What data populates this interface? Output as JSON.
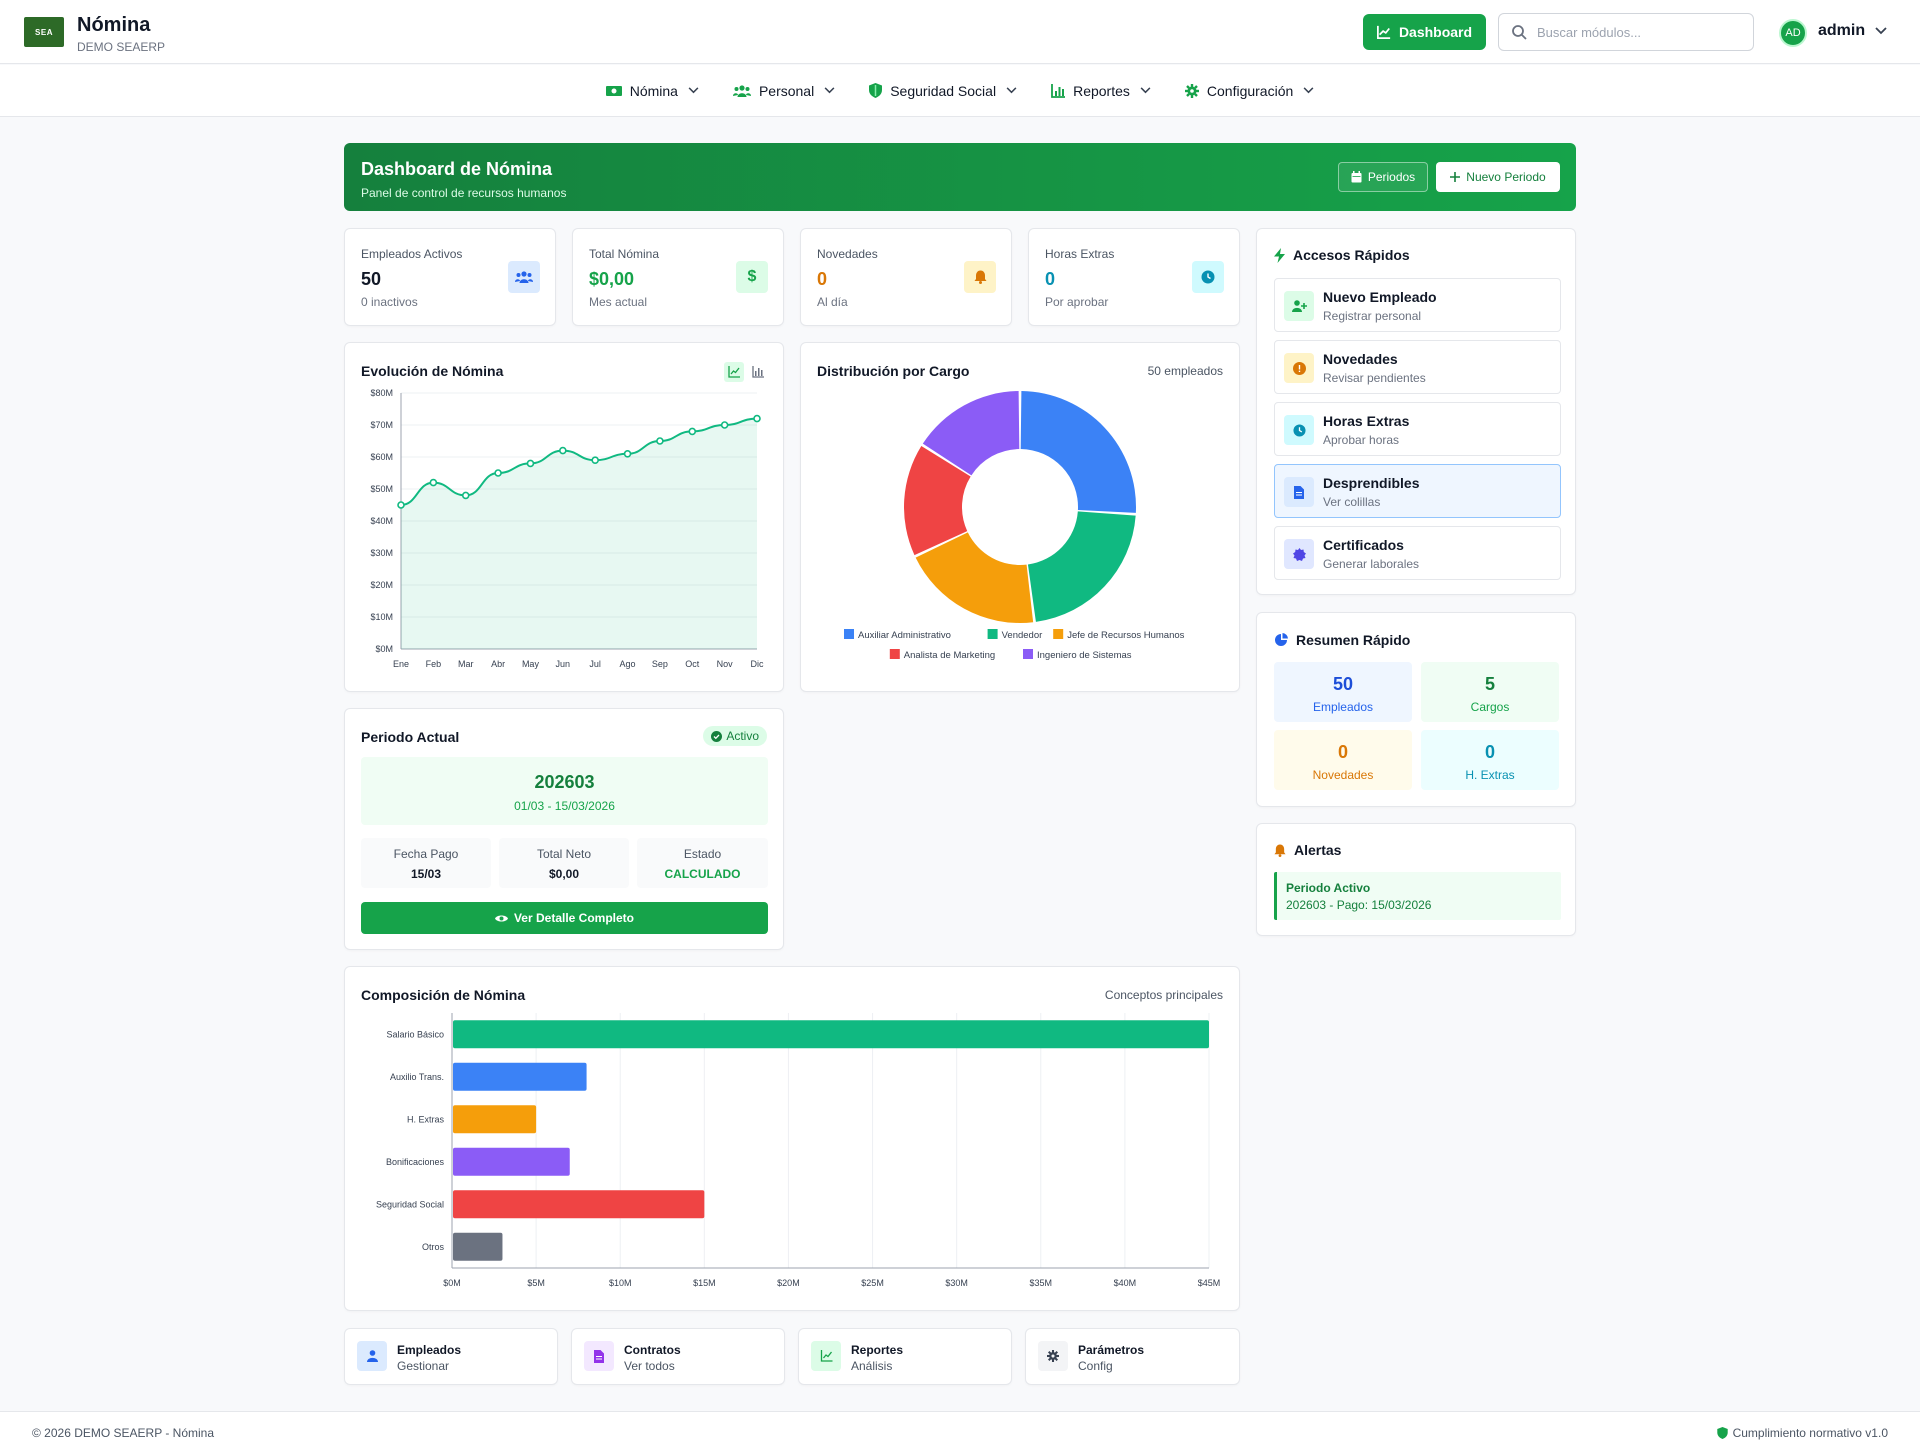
{
  "header": {
    "logo_text": "SEA",
    "title": "Nómina",
    "subtitle": "DEMO SEAERP",
    "dashboard_label": "Dashboard",
    "search_placeholder": "Buscar módulos...",
    "avatar_initials": "AD",
    "user_name": "admin"
  },
  "nav": {
    "items": [
      {
        "label": "Nómina",
        "icon": "money-icon"
      },
      {
        "label": "Personal",
        "icon": "users-icon"
      },
      {
        "label": "Seguridad Social",
        "icon": "shield-icon"
      },
      {
        "label": "Reportes",
        "icon": "chart-icon"
      },
      {
        "label": "Configuración",
        "icon": "gear-icon"
      }
    ]
  },
  "banner": {
    "title": "Dashboard de Nómina",
    "subtitle": "Panel de control de recursos humanos",
    "periodos_label": "Periodos",
    "nuevo_label": "Nuevo Periodo"
  },
  "stats": [
    {
      "label": "Empleados Activos",
      "value": "50",
      "sub": "0 inactivos",
      "color": "#111827",
      "icon": "users-icon"
    },
    {
      "label": "Total Nómina",
      "value": "$0,00",
      "sub": "Mes actual",
      "color": "#16a34a",
      "icon": "dollar-icon"
    },
    {
      "label": "Novedades",
      "value": "0",
      "sub": "Al día",
      "color": "#d97706",
      "icon": "bell-icon"
    },
    {
      "label": "Horas Extras",
      "value": "0",
      "sub": "Por aprobar",
      "color": "#0891b2",
      "icon": "clock-icon"
    }
  ],
  "evolucion": {
    "title": "Evolución de Nómina"
  },
  "distribucion": {
    "title": "Distribución por Cargo",
    "meta": "50 empleados"
  },
  "periodo": {
    "title": "Periodo Actual",
    "badge": "Activo",
    "code": "202603",
    "range": "01/03 - 15/03/2026",
    "fecha_label": "Fecha Pago",
    "fecha_value": "15/03",
    "neto_label": "Total Neto",
    "neto_value": "$0,00",
    "estado_label": "Estado",
    "estado_value": "CALCULADO",
    "button_label": "Ver Detalle Completo"
  },
  "composicion": {
    "title": "Composición de Nómina",
    "meta": "Conceptos principales"
  },
  "accesos": {
    "title": "Accesos Rápidos",
    "items": [
      {
        "title": "Nuevo Empleado",
        "sub": "Registrar personal",
        "icon": "user-plus-icon"
      },
      {
        "title": "Novedades",
        "sub": "Revisar pendientes",
        "icon": "alert-icon"
      },
      {
        "title": "Horas Extras",
        "sub": "Aprobar horas",
        "icon": "clock-icon"
      },
      {
        "title": "Desprendibles",
        "sub": "Ver colillas",
        "icon": "document-icon"
      },
      {
        "title": "Certificados",
        "sub": "Generar laborales",
        "icon": "certificate-icon"
      }
    ]
  },
  "resumen": {
    "title": "Resumen Rápido",
    "boxes": [
      {
        "num": "50",
        "label": "Empleados"
      },
      {
        "num": "5",
        "label": "Cargos"
      },
      {
        "num": "0",
        "label": "Novedades"
      },
      {
        "num": "0",
        "label": "H. Extras"
      }
    ]
  },
  "alertas": {
    "title": "Alertas",
    "item_title": "Periodo Activo",
    "item_text": "202603 - Pago: 15/03/2026"
  },
  "bottom_cards": [
    {
      "title": "Empleados",
      "sub": "Gestionar",
      "icon": "user-icon"
    },
    {
      "title": "Contratos",
      "sub": "Ver todos",
      "icon": "file-icon"
    },
    {
      "title": "Reportes",
      "sub": "Análisis",
      "icon": "line-chart-icon"
    },
    {
      "title": "Parámetros",
      "sub": "Config",
      "icon": "gear-icon"
    }
  ],
  "footer": {
    "left": "© 2026 DEMO SEAERP - Nómina",
    "right": "Cumplimiento normativo v1.0"
  },
  "colors": {
    "primary": "#16a34a",
    "blue": "#3b82f6",
    "green": "#10b981",
    "orange": "#f59e0b",
    "red": "#ef4444",
    "purple": "#8b5cf6",
    "gray": "#6b7280"
  },
  "chart_data": [
    {
      "type": "area",
      "title": "Evolución de Nómina",
      "categories": [
        "Ene",
        "Feb",
        "Mar",
        "Abr",
        "May",
        "Jun",
        "Jul",
        "Ago",
        "Sep",
        "Oct",
        "Nov",
        "Dic"
      ],
      "values": [
        45,
        52,
        48,
        55,
        58,
        62,
        59,
        61,
        65,
        68,
        70,
        72
      ],
      "y_ticks": [
        "$0M",
        "$10M",
        "$20M",
        "$30M",
        "$40M",
        "$50M",
        "$60M",
        "$70M",
        "$80M"
      ],
      "ylim": [
        0,
        80
      ],
      "color": "#10b981"
    },
    {
      "type": "pie",
      "title": "Distribución por Cargo",
      "labels": [
        "Auxiliar Administrativo",
        "Vendedor",
        "Jefe de Recursos Humanos",
        "Analista de Marketing",
        "Ingeniero de Sistemas"
      ],
      "values": [
        13,
        11,
        10,
        8,
        8
      ],
      "colors": [
        "#3b82f6",
        "#10b981",
        "#f59e0b",
        "#ef4444",
        "#8b5cf6"
      ],
      "legend": "bottom"
    },
    {
      "type": "bar",
      "orientation": "horizontal",
      "title": "Composición de Nómina",
      "categories": [
        "Salario Básico",
        "Auxilio Trans.",
        "H. Extras",
        "Bonificaciones",
        "Seguridad Social",
        "Otros"
      ],
      "values": [
        45,
        8,
        5,
        7,
        15,
        3
      ],
      "colors": [
        "#10b981",
        "#3b82f6",
        "#f59e0b",
        "#8b5cf6",
        "#ef4444",
        "#6b7280"
      ],
      "x_ticks": [
        "$0M",
        "$5M",
        "$10M",
        "$15M",
        "$20M",
        "$25M",
        "$30M",
        "$35M",
        "$40M",
        "$45M"
      ],
      "xlim": [
        0,
        45
      ]
    }
  ]
}
